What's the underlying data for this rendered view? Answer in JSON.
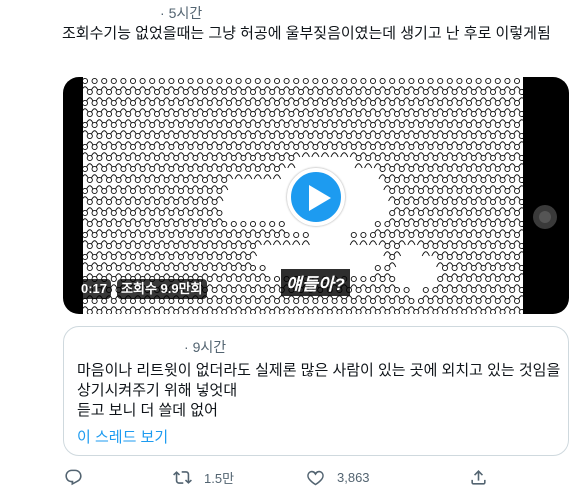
{
  "tweet": {
    "time": "5시간",
    "text": "조회수기능 없었을때는 그냥 허공에 울부짖음이였는데 생기고 난 후로 이렇게됨"
  },
  "video": {
    "duration": "0:17",
    "views": "조회수 9.9만회",
    "subtitle": "얘들아?"
  },
  "quote": {
    "time": "9시간",
    "text_line1": "마음이나 리트윗이 없더라도 실제론 많은 사람이 있는 곳에 외치고 있는 것임을 상기시켜주기 위해 넣엇대",
    "text_line2": "듣고 보니 더 쓸데 없어",
    "thread_link": "이 스레드 보기"
  },
  "actions": {
    "retweet_count": "1.5만",
    "like_count": "3,863"
  },
  "colors": {
    "accent": "#1d9bf0",
    "muted": "#536471",
    "border": "#cfd9de"
  }
}
